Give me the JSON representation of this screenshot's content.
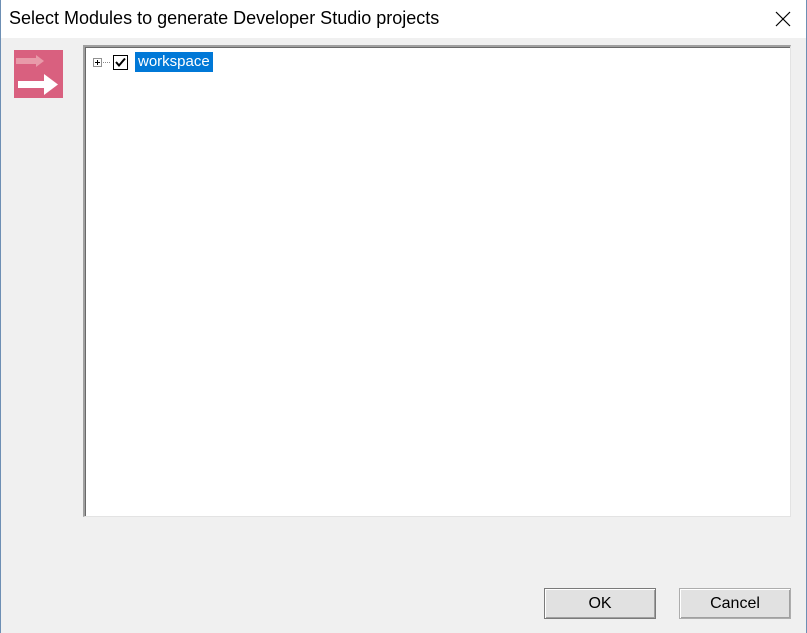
{
  "window": {
    "title": "Select Modules to generate Developer Studio projects"
  },
  "logo": {
    "icon": "arrow-logo-icon",
    "background_color": "#d9607f"
  },
  "tree": {
    "nodes": [
      {
        "label": "workspace",
        "checked": true,
        "expanded": false,
        "selected": true
      }
    ],
    "selection_color": "#0078d7"
  },
  "buttons": {
    "ok_label": "OK",
    "cancel_label": "Cancel"
  }
}
